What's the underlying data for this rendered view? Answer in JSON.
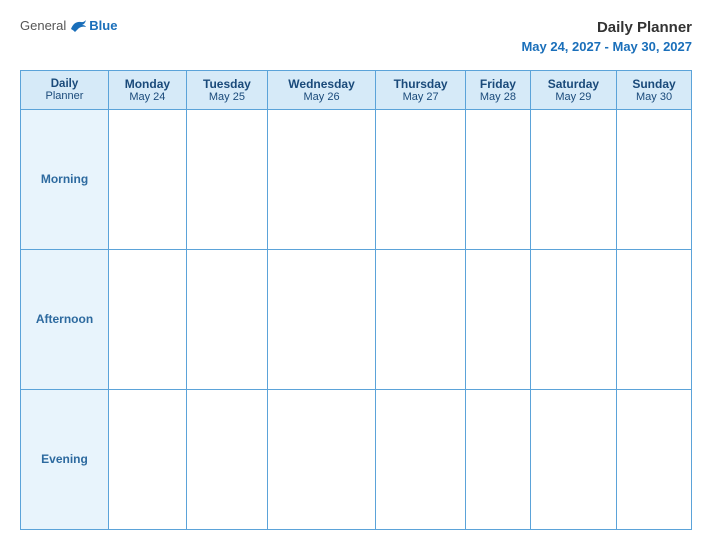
{
  "logo": {
    "general": "General",
    "blue": "Blue"
  },
  "title": {
    "main": "Daily Planner",
    "date_range": "May 24, 2027 - May 30, 2027"
  },
  "header_row": {
    "planner_label_line1": "Daily",
    "planner_label_line2": "Planner",
    "days": [
      {
        "name": "Monday",
        "date": "May 24"
      },
      {
        "name": "Tuesday",
        "date": "May 25"
      },
      {
        "name": "Wednesday",
        "date": "May 26"
      },
      {
        "name": "Thursday",
        "date": "May 27"
      },
      {
        "name": "Friday",
        "date": "May 28"
      },
      {
        "name": "Saturday",
        "date": "May 29"
      },
      {
        "name": "Sunday",
        "date": "May 30"
      }
    ]
  },
  "time_slots": [
    {
      "label": "Morning"
    },
    {
      "label": "Afternoon"
    },
    {
      "label": "Evening"
    }
  ]
}
